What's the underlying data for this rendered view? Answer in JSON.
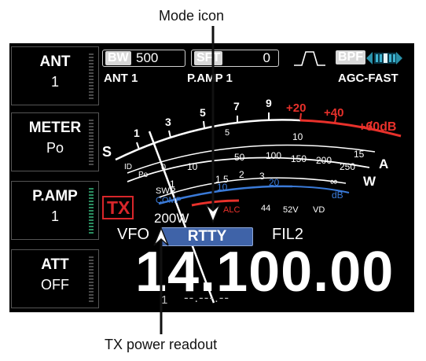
{
  "callouts": {
    "mode_icon": "Mode icon",
    "tx_power": "TX power readout"
  },
  "side_buttons": [
    {
      "title": "ANT",
      "value": "1"
    },
    {
      "title": "METER",
      "value": "Po"
    },
    {
      "title": "P.AMP",
      "value": "1"
    },
    {
      "title": "ATT",
      "value": "OFF"
    }
  ],
  "status": {
    "bw_label": "BW",
    "bw_value": "500",
    "sft_label": "SFT",
    "sft_value": "0",
    "bpf_label": "BPF",
    "ant": "ANT 1",
    "pamp": "P.AMP 1",
    "agc": "AGC-FAST"
  },
  "meter": {
    "s_label": "S",
    "s_ticks": [
      "1",
      "3",
      "5",
      "7",
      "9"
    ],
    "s_plus_ticks": [
      "+20",
      "+40",
      "+60dB"
    ],
    "ld_label": "ID",
    "po_label": "Po",
    "po_ticks": [
      "0",
      "10",
      "50",
      "100",
      "150",
      "200",
      "250"
    ],
    "po_unit": "W",
    "id_ticks": [
      "5",
      "10",
      "15"
    ],
    "id_unit": "A",
    "swr_label": "SWR",
    "swr_ticks": [
      "1",
      "1.5",
      "2",
      "3",
      "∞"
    ],
    "comp_label": "COMP",
    "comp_ticks": [
      "10",
      "20"
    ],
    "comp_unit": "dB",
    "alc_label": "ALC",
    "vd_ticks": [
      "44",
      "52V"
    ],
    "vd_label": "VD"
  },
  "tx_badge": "TX",
  "power_readout": "200W",
  "vfo_label": "VFO",
  "mode": "RTTY",
  "filter": "FIL2",
  "frequency": "14.100.00",
  "sub_vfo": "1",
  "sub_frequency": "--.---.--",
  "colors": {
    "meter_red": "#e8312b",
    "meter_blue": "#3a7ad8",
    "mode_bg": "#3f63a8",
    "tx_red": "#d8262a"
  }
}
